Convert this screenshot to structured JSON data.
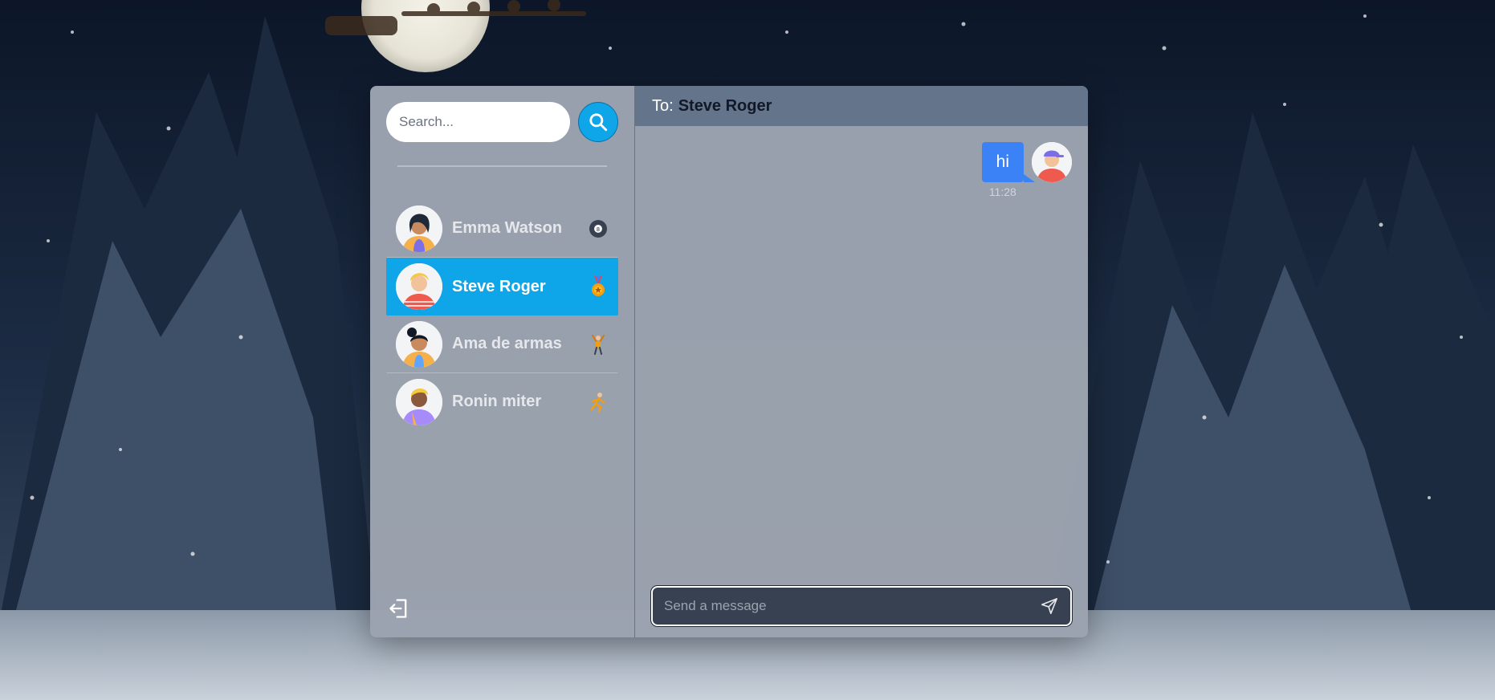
{
  "colors": {
    "accent": "#0ea5e9",
    "panel": "#9ca3af",
    "header": "#64748b",
    "bubble": "#3b82f6",
    "composer": "#374151"
  },
  "sidebar": {
    "search": {
      "placeholder": "Search..."
    },
    "search_button_icon": "search-icon",
    "contacts": [
      {
        "name": "Emma Watson",
        "status_icon": "8-ball-icon",
        "active": false
      },
      {
        "name": "Steve Roger",
        "status_icon": "medal-icon",
        "active": true
      },
      {
        "name": "Ama de armas",
        "status_icon": "person-cheering-icon",
        "active": false
      },
      {
        "name": "Ronin miter",
        "status_icon": "person-running-icon",
        "active": false
      }
    ],
    "logout_icon": "logout-icon"
  },
  "chat": {
    "header": {
      "prefix": "To:",
      "recipient": "Steve Roger"
    },
    "messages": [
      {
        "text": "hi",
        "time": "11:28",
        "from_me": true
      }
    ],
    "composer": {
      "placeholder": "Send a message",
      "send_icon": "send-icon"
    }
  }
}
